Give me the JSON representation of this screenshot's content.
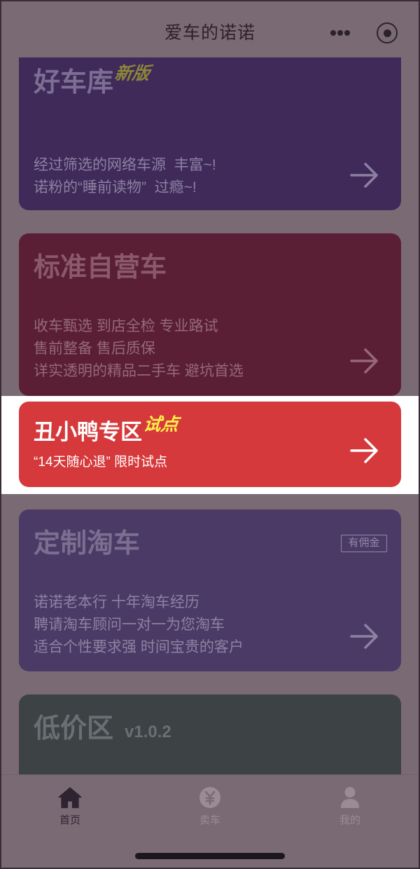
{
  "nav": {
    "title": "爱车的诺诺",
    "icons": [
      "more-dots-icon",
      "target-circle-icon"
    ]
  },
  "cards": [
    {
      "title": "好车库",
      "tag": "新版",
      "lines": [
        "经过筛选的网络车源  丰富~!",
        "诺粉的“睡前读物”  过瘾~!"
      ],
      "color": "#3f2a5a",
      "icon": "arrow-right-icon",
      "highlighted": false
    },
    {
      "title": "标准自营车",
      "lines": [
        "收车甄选 到店全检 专业路试",
        "售前整备 售后质保",
        "详实透明的精品二手车 避坑首选"
      ],
      "color": "#5b1f35",
      "icon": "arrow-right-icon",
      "highlighted": false
    },
    {
      "title": "丑小鸭专区",
      "tag": "试点",
      "lines": [
        "“14天随心退” 限时试点"
      ],
      "color": "#d6393b",
      "icon": "arrow-right-icon",
      "highlighted": true
    },
    {
      "title": "定制淘车",
      "badge": "有佣金",
      "lines": [
        "诺诺老本行 十年淘车经历",
        "聘请淘车顾问一对一为您淘车",
        "适合个性要求强 时间宝贵的客户"
      ],
      "color": "#4b3a66",
      "icon": "arrow-right-icon",
      "highlighted": false
    },
    {
      "title": "低价区",
      "version": "v1.0.2",
      "color": "#3d4245",
      "highlighted": false
    }
  ],
  "tabbar": {
    "items": [
      {
        "label": "首页",
        "icon": "home-icon",
        "active": true
      },
      {
        "label": "卖车",
        "icon": "yen-circle-icon",
        "active": false
      },
      {
        "label": "我的",
        "icon": "person-icon",
        "active": false
      }
    ]
  },
  "colors": {
    "dimmed_background": "#7a6a74",
    "spotlight_background": "#ffffff",
    "tag_yellow": "#fff04a"
  }
}
